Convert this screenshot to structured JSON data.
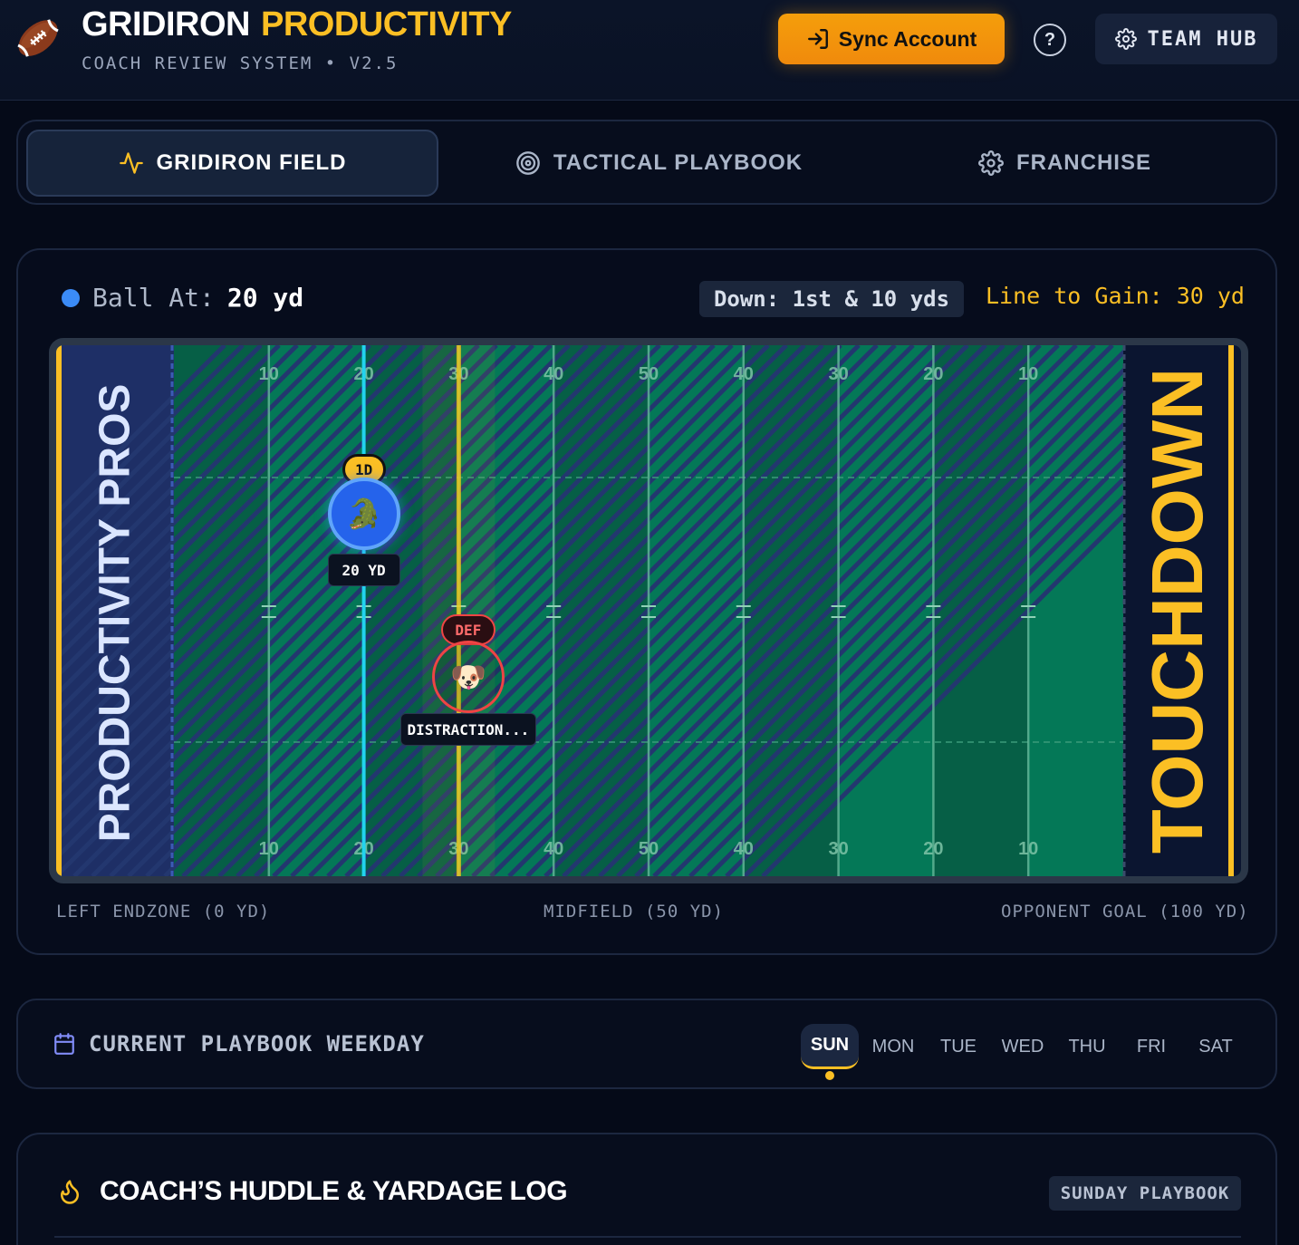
{
  "header": {
    "title_white": "GRIDIRON",
    "title_yellow": "PRODUCTIVITY",
    "subtitle": "COACH REVIEW SYSTEM • V2.5",
    "sync_label": "Sync Account",
    "help_label": "?",
    "hub_label": "TEAM HUB"
  },
  "tabs": [
    {
      "label": "GRIDIRON FIELD",
      "icon": "activity-icon",
      "active": true
    },
    {
      "label": "TACTICAL PLAYBOOK",
      "icon": "target-icon",
      "active": false
    },
    {
      "label": "FRANCHISE",
      "icon": "gear-icon",
      "active": false
    }
  ],
  "field": {
    "ball_label": "Ball At:",
    "ball_value": "20 yd",
    "down_label": "Down: 1st & 10 yds",
    "gain_label": "Line to Gain: 30 yd",
    "left_endzone_text": "PRODUCTIVITY PROS",
    "right_endzone_text": "TOUCHDOWN",
    "yard_numbers": [
      "10",
      "20",
      "30",
      "40",
      "50",
      "40",
      "30",
      "20",
      "10"
    ],
    "ball_yard": 20,
    "line_to_gain_yard": 30,
    "first_down_chip": "1D",
    "player_emoji": "🐊",
    "player_tag": "20 YD",
    "defender_chip": "DEF",
    "defender_emoji": "🐶",
    "defender_tag": "DISTRACTION...",
    "defender_yard": 31,
    "foot_left": "LEFT ENDZONE (0 YD)",
    "foot_mid": "MIDFIELD (50 YD)",
    "foot_right": "OPPONENT GOAL (100 YD)",
    "colors": {
      "ball_line": "#22d3ee",
      "gain_line": "#facc15",
      "turf": "#047857",
      "turf_dark": "#065f46"
    }
  },
  "weekday": {
    "title": "CURRENT PLAYBOOK WEEKDAY",
    "days": [
      "SUN",
      "MON",
      "TUE",
      "WED",
      "THU",
      "FRI",
      "SAT"
    ],
    "active": "SUN"
  },
  "huddle": {
    "title": "COACH’S HUDDLE & YARDAGE LOG",
    "pill": "SUNDAY PLAYBOOK"
  }
}
